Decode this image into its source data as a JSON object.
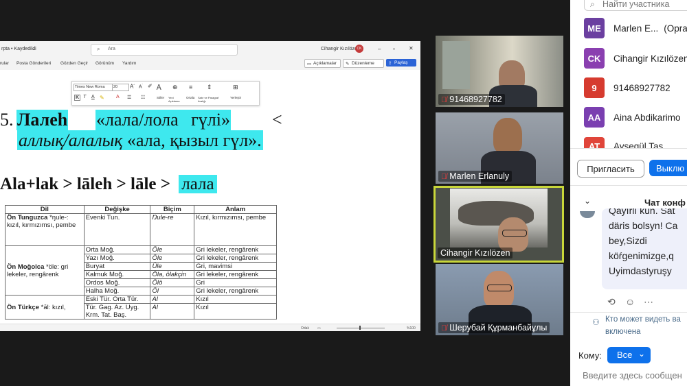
{
  "word": {
    "title_left": "rpta • Kaydedildi",
    "search_placeholder": "Ara",
    "user_name": "Cihangir Kızılözen",
    "user_initials": "CK",
    "menu": [
      "rular",
      "Posta Gönderileri",
      "Gözden Geçir",
      "Görünüm",
      "Yardım"
    ],
    "btn_comments": "Açıklamalar",
    "btn_editing": "Düzenleme",
    "btn_share": "Paylaş",
    "format_toolbar": {
      "font": "Times New Roma",
      "size": "20",
      "labels": [
        "Stiller",
        "Yeni Açıklama",
        "Ortala",
        "Satır ve Paragraf Aralığı",
        "Yerleştir"
      ]
    },
    "heading5": {
      "number": "5.",
      "word": "Лалеh",
      "phrase": "«лала/лола гүлі»",
      "symbol": "<",
      "line2_italic": "аллық/алалық",
      "line2_rest": "«ала, қызыл гүл»."
    },
    "etym_line": {
      "a": "Ala+lak",
      "s1": ">",
      "b": "lāleh",
      "s2": ">",
      "c": "lāle",
      "s3": ">",
      "d": "лала"
    },
    "table": {
      "headers": [
        "Dil",
        "Değişke",
        "Biçim",
        "Anlam"
      ],
      "groups": [
        {
          "dil_bold": "Ön Tunguzca",
          "dil_rest": "*ŋule-: kızıl, kırmızımsı, pembe",
          "rows": [
            [
              "Evenki Tun.",
              "Ŋule-re",
              "Kızıl, kırmızımsı, pembe"
            ]
          ]
        },
        {
          "dil_bold": "Ön Moğolca",
          "dil_rest": "*öle: gri lekeler, rengârenk",
          "rows": [
            [
              "Orta Moğ.",
              "Öle",
              "Gri lekeler, rengârenk"
            ],
            [
              "Yazı Moğ.",
              "Öle",
              "Gri lekeler, rengârenk"
            ],
            [
              "Buryat",
              "Üle",
              "Gri, mavimsi"
            ],
            [
              "Kalmuk Moğ.",
              "Öla, ölakçin",
              "Gri lekeler, rengârenk"
            ],
            [
              "Ordos Moğ.",
              "Ölö",
              "Gri"
            ],
            [
              "Halha Moğ.",
              "Öl",
              "Gri lekeler, rengârenk"
            ]
          ]
        },
        {
          "dil_bold": "Ön Türkçe",
          "dil_rest": "*āl: kızıl,",
          "rows": [
            [
              "Eski Tür. Orta Tür.",
              "Al",
              "Kızıl"
            ],
            [
              "Tür. Gag. Az. Uyg. Krm. Tat. Baş.",
              "Al",
              "Kızıl"
            ]
          ]
        }
      ]
    },
    "status": {
      "focus": "Odak",
      "zoom": "%100"
    }
  },
  "tiles": [
    {
      "name": "91468927782"
    },
    {
      "name": "Marlen Erlanuly"
    },
    {
      "name": "Cihangir Kızılözen"
    },
    {
      "name": "Шерубай Құрманбайұлы"
    }
  ],
  "panel": {
    "search_placeholder": "Найти участника",
    "participants": [
      {
        "initials": "ME",
        "name": "Marlen E...",
        "extra": "(Opra",
        "color": "#6b3fa0"
      },
      {
        "initials": "CK",
        "name": "Cihangir Kızılözen",
        "extra": "",
        "color": "#8a3fb0"
      },
      {
        "initials": "9",
        "name": "91468927782",
        "extra": "",
        "color": "#d63b2f"
      },
      {
        "initials": "AA",
        "name": "Aina Abdikarimo",
        "extra": "",
        "color": "#7a3fb0"
      },
      {
        "initials": "AT",
        "name": "Aysegül Tas",
        "extra": "",
        "color": "#e0453a"
      }
    ],
    "invite_label": "Пригласить",
    "mute_label": "Выклю",
    "chat_title": "Чат конф",
    "chat_lines": [
      "Qayırlı kün. Sat",
      "däris bolsyn! Ca",
      "bey,Sizdi",
      "köŕgenimizge,q",
      "Uyimdastyruşy"
    ],
    "visibility_line1": "Кто может видеть ва",
    "visibility_line2": "включена",
    "to_label": "Кому:",
    "to_value": "Все",
    "input_placeholder": "Введите здесь сообщен"
  }
}
